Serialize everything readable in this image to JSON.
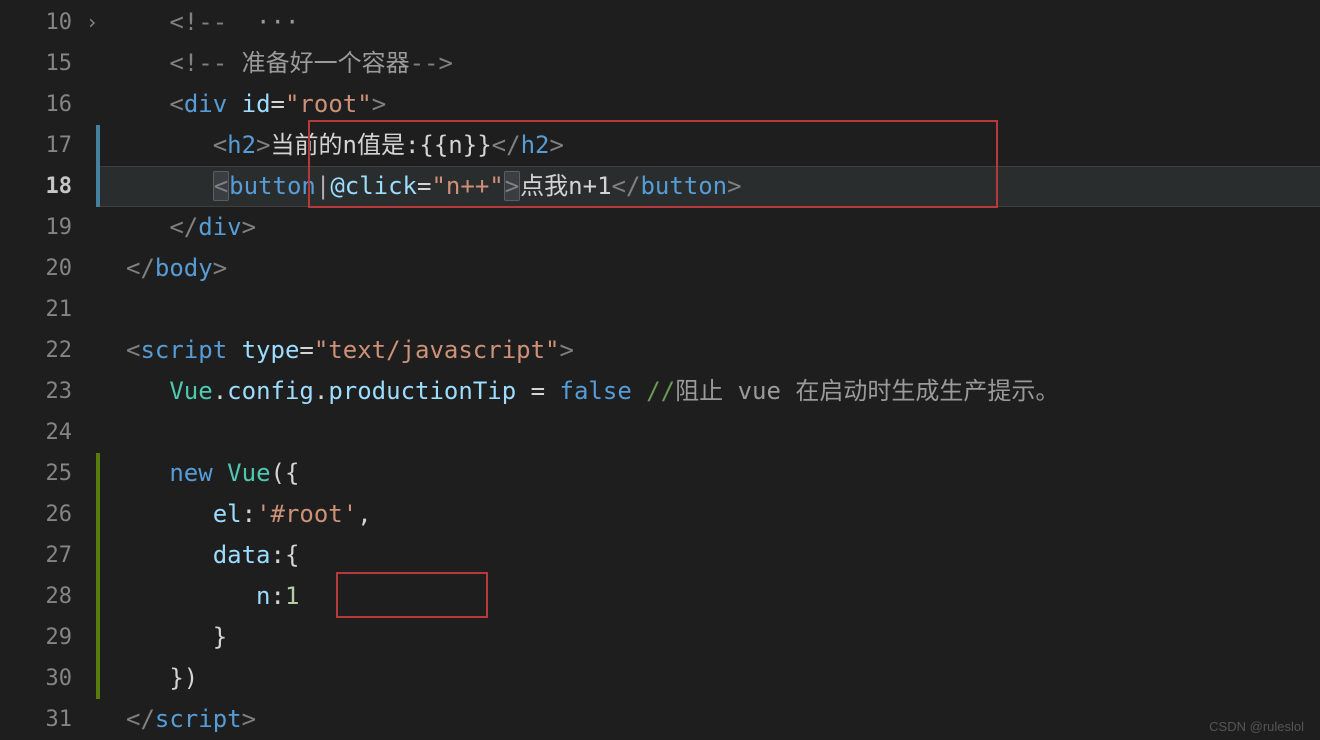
{
  "gutter": {
    "line_numbers": [
      "10",
      "15",
      "16",
      "17",
      "18",
      "19",
      "20",
      "21",
      "22",
      "23",
      "24",
      "25",
      "26",
      "27",
      "28",
      "29",
      "30",
      "31"
    ],
    "active_line": "18",
    "fold_indicator": "›"
  },
  "code": {
    "line10": {
      "open": "<!--",
      "ellipsis": "  ···"
    },
    "line15": {
      "open": "<!--",
      "comment": " 准备好一个容器",
      "close": "-->"
    },
    "line16": {
      "lt": "<",
      "tag": "div",
      "attr": "id",
      "eq": "=",
      "val": "\"root\"",
      "gt": ">"
    },
    "line17": {
      "lt1": "<",
      "tag1": "h2",
      "gt1": ">",
      "text": "当前的n值是:{{n}}",
      "lt2": "</",
      "tag2": "h2",
      "gt2": ">"
    },
    "line18": {
      "lt1": "<",
      "tag1": "button",
      "cursor": "|",
      "attr": "@click",
      "eq": "=",
      "val": "\"n++\"",
      "gt1": ">",
      "text": "点我n+1",
      "lt2": "</",
      "tag2": "button",
      "gt2": ">"
    },
    "line19": {
      "lt": "</",
      "tag": "div",
      "gt": ">"
    },
    "line20": {
      "lt": "</",
      "tag": "body",
      "gt": ">"
    },
    "line22": {
      "lt": "<",
      "tag": "script",
      "attr": "type",
      "eq": "=",
      "val": "\"text/javascript\"",
      "gt": ">"
    },
    "line23": {
      "obj": "Vue",
      "dot1": ".",
      "prop1": "config",
      "dot2": ".",
      "prop2": "productionTip",
      "eq": " = ",
      "val": "false",
      "comment_marker": " //",
      "comment": "阻止 vue 在启动时生成生产提示。"
    },
    "line25": {
      "kw": "new",
      "cls": " Vue",
      "open": "({"
    },
    "line26": {
      "prop": "el",
      "colon": ":",
      "val": "'#root'",
      "comma": ","
    },
    "line27": {
      "prop": "data",
      "colon": ":",
      "open": "{"
    },
    "line28": {
      "prop": "n",
      "colon": ":",
      "val": "1"
    },
    "line29": {
      "close": "}"
    },
    "line30": {
      "close": "})"
    },
    "line31": {
      "lt": "</",
      "tag": "script",
      "gt": ">"
    }
  },
  "watermark": "CSDN @ruleslol"
}
